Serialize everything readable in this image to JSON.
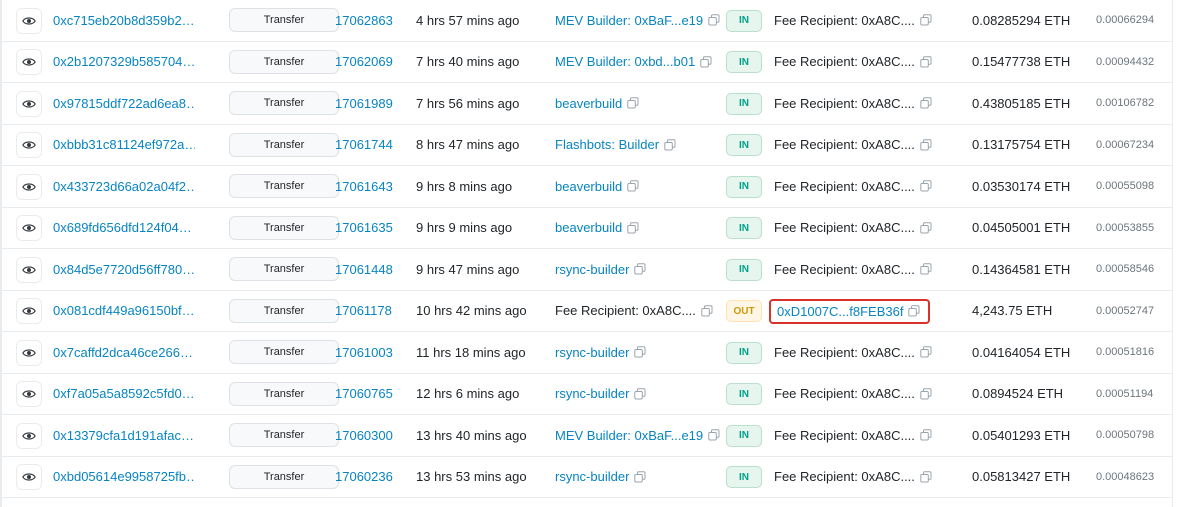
{
  "icons": {
    "eye": "eye-icon",
    "copy": "copy-icon"
  },
  "colors": {
    "link": "#0784c3",
    "in_badge": "#00a186",
    "out_badge": "#cc9a06",
    "highlight_border": "#d9322b"
  },
  "transactions": [
    {
      "hash": "0xc715eb20b8d359b2…",
      "method": "Transfer",
      "block": "17062863",
      "age": "4 hrs 57 mins ago",
      "from": "MEV Builder: 0xBaF...e19",
      "from_link": true,
      "direction": "IN",
      "to": "Fee Recipient: 0xA8C....",
      "value": "0.08285294 ETH",
      "fee": "0.00066294"
    },
    {
      "hash": "0x2b1207329b585704…",
      "method": "Transfer",
      "block": "17062069",
      "age": "7 hrs 40 mins ago",
      "from": "MEV Builder: 0xbd...b01",
      "from_link": true,
      "direction": "IN",
      "to": "Fee Recipient: 0xA8C....",
      "value": "0.15477738 ETH",
      "fee": "0.00094432"
    },
    {
      "hash": "0x97815ddf722ad6ea8…",
      "method": "Transfer",
      "block": "17061989",
      "age": "7 hrs 56 mins ago",
      "from": "beaverbuild",
      "from_link": true,
      "direction": "IN",
      "to": "Fee Recipient: 0xA8C....",
      "value": "0.43805185 ETH",
      "fee": "0.00106782"
    },
    {
      "hash": "0xbbb31c81124ef972a…",
      "method": "Transfer",
      "block": "17061744",
      "age": "8 hrs 47 mins ago",
      "from": "Flashbots: Builder",
      "from_link": true,
      "direction": "IN",
      "to": "Fee Recipient: 0xA8C....",
      "value": "0.13175754 ETH",
      "fee": "0.00067234"
    },
    {
      "hash": "0x433723d66a02a04f2…",
      "method": "Transfer",
      "block": "17061643",
      "age": "9 hrs 8 mins ago",
      "from": "beaverbuild",
      "from_link": true,
      "direction": "IN",
      "to": "Fee Recipient: 0xA8C....",
      "value": "0.03530174 ETH",
      "fee": "0.00055098"
    },
    {
      "hash": "0x689fd656dfd124f04…",
      "method": "Transfer",
      "block": "17061635",
      "age": "9 hrs 9 mins ago",
      "from": "beaverbuild",
      "from_link": true,
      "direction": "IN",
      "to": "Fee Recipient: 0xA8C....",
      "value": "0.04505001 ETH",
      "fee": "0.00053855"
    },
    {
      "hash": "0x84d5e7720d56ff780…",
      "method": "Transfer",
      "block": "17061448",
      "age": "9 hrs 47 mins ago",
      "from": "rsync-builder",
      "from_link": true,
      "direction": "IN",
      "to": "Fee Recipient: 0xA8C....",
      "value": "0.14364581 ETH",
      "fee": "0.00058546"
    },
    {
      "hash": "0x081cdf449a96150bf…",
      "method": "Transfer",
      "block": "17061178",
      "age": "10 hrs 42 mins ago",
      "from": "Fee Recipient: 0xA8C....",
      "from_link": false,
      "direction": "OUT",
      "to": "0xD1007C...f8FEB36f",
      "to_highlight": true,
      "value": "4,243.75 ETH",
      "fee": "0.00052747"
    },
    {
      "hash": "0x7caffd2dca46ce266…",
      "method": "Transfer",
      "block": "17061003",
      "age": "11 hrs 18 mins ago",
      "from": "rsync-builder",
      "from_link": true,
      "direction": "IN",
      "to": "Fee Recipient: 0xA8C....",
      "value": "0.04164054 ETH",
      "fee": "0.00051816"
    },
    {
      "hash": "0xf7a05a5a8592c5fd0…",
      "method": "Transfer",
      "block": "17060765",
      "age": "12 hrs 6 mins ago",
      "from": "rsync-builder",
      "from_link": true,
      "direction": "IN",
      "to": "Fee Recipient: 0xA8C....",
      "value": "0.0894524 ETH",
      "fee": "0.00051194"
    },
    {
      "hash": "0x13379cfa1d191afac…",
      "method": "Transfer",
      "block": "17060300",
      "age": "13 hrs 40 mins ago",
      "from": "MEV Builder: 0xBaF...e19",
      "from_link": true,
      "direction": "IN",
      "to": "Fee Recipient: 0xA8C....",
      "value": "0.05401293 ETH",
      "fee": "0.00050798"
    },
    {
      "hash": "0xbd05614e9958725fb…",
      "method": "Transfer",
      "block": "17060236",
      "age": "13 hrs 53 mins ago",
      "from": "rsync-builder",
      "from_link": true,
      "direction": "IN",
      "to": "Fee Recipient: 0xA8C....",
      "value": "0.05813427 ETH",
      "fee": "0.00048623"
    }
  ]
}
